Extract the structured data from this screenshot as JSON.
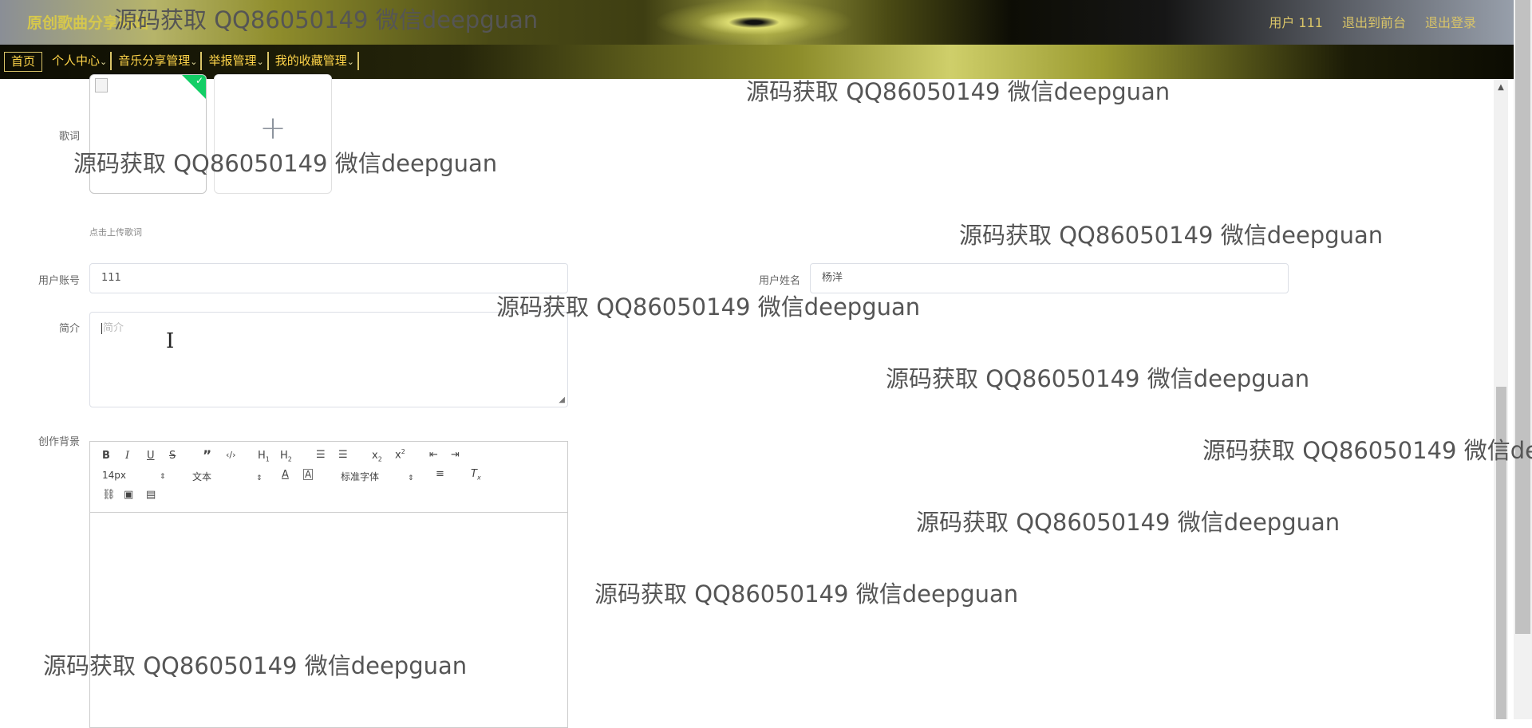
{
  "header": {
    "site_title": "原创歌曲分享网站",
    "links": [
      "用户 111",
      "退出到前台",
      "退出登录"
    ]
  },
  "nav": {
    "items": [
      "首页",
      "个人中心",
      "音乐分享管理",
      "举报管理",
      "我的收藏管理"
    ],
    "caret": "⌄"
  },
  "form": {
    "lyrics_label": "歌词",
    "upload_tip": "点击上传歌词",
    "account_label": "用户账号",
    "account_value": "111",
    "name_label": "用户姓名",
    "name_value": "杨洋",
    "intro_label": "简介",
    "intro_placeholder": "简介",
    "background_label": "创作背景"
  },
  "editor": {
    "font_size": "14px",
    "text_type": "文本",
    "font_family": "标准字体"
  },
  "watermark_text": "源码获取 QQ86050149 微信deepguan",
  "colors": {
    "nav_text": "#ffd54a",
    "header_link": "#d9c468",
    "upload_success": "#13ce66"
  }
}
